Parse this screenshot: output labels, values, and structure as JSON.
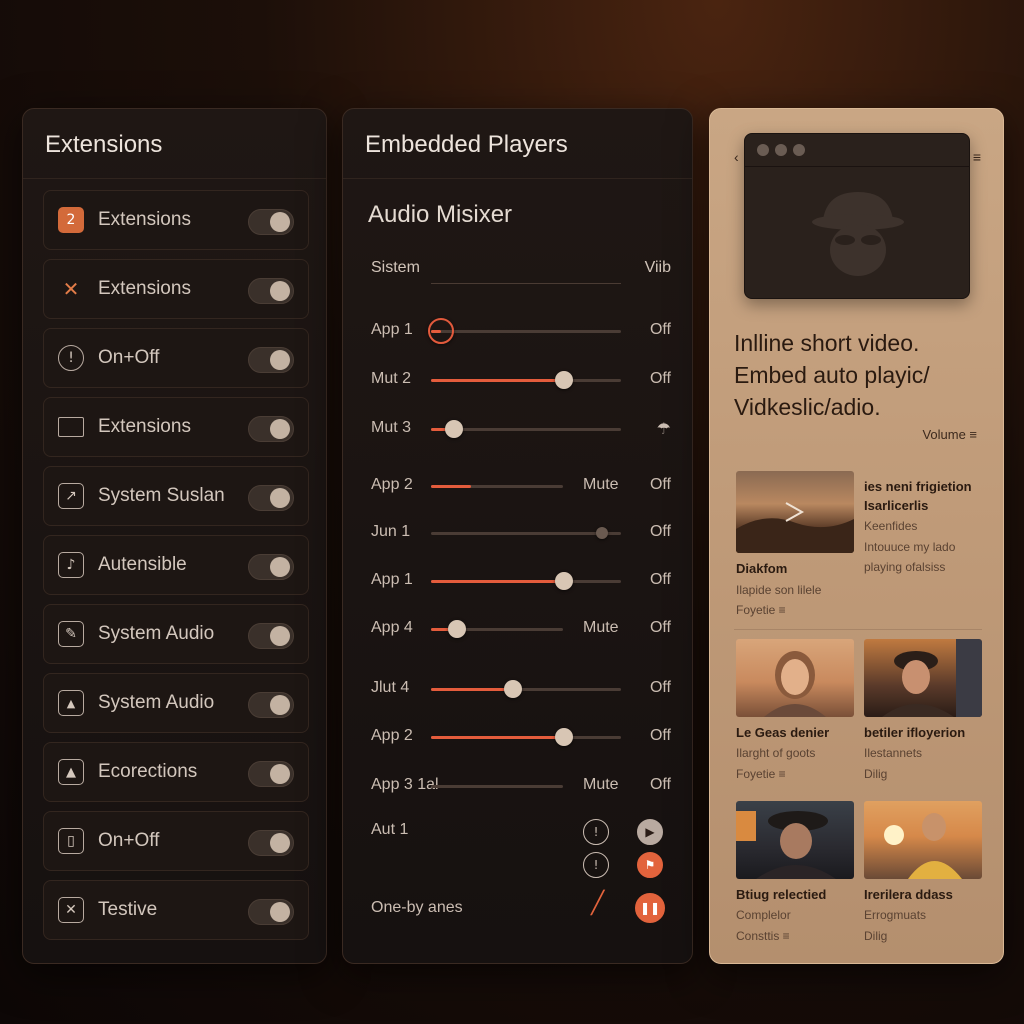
{
  "extensions": {
    "title": "Extensions",
    "items": [
      {
        "label": "Extensions",
        "icon": "puzzle-icon",
        "glyph": "2"
      },
      {
        "label": "Extensions",
        "icon": "cross-icon",
        "glyph": "✕"
      },
      {
        "label": "On+Off",
        "icon": "info-icon",
        "glyph": "!"
      },
      {
        "label": "Extensions",
        "icon": "window-icon",
        "glyph": ""
      },
      {
        "label": "System Suslan",
        "icon": "arrow-icon",
        "glyph": "↗"
      },
      {
        "label": "Autensible",
        "icon": "music-note-icon",
        "glyph": "♪"
      },
      {
        "label": "System Audio",
        "icon": "pen-icon",
        "glyph": "✎"
      },
      {
        "label": "System Audio",
        "icon": "image-icon",
        "glyph": "▲"
      },
      {
        "label": "Ecorections",
        "icon": "warning-icon",
        "glyph": "▲"
      },
      {
        "label": "On+Off",
        "icon": "battery-icon",
        "glyph": "▯"
      },
      {
        "label": "Testive",
        "icon": "close-icon",
        "glyph": "✕"
      }
    ]
  },
  "embedded": {
    "title": "Embedded Players",
    "mixer_title": "Audio Misixer",
    "header_left": "Sistem",
    "header_right": "Viib",
    "rows": [
      {
        "label": "App 1",
        "value": 0.05,
        "mute": "",
        "off": "Off",
        "knob": "ring"
      },
      {
        "label": "Mut 2",
        "value": 0.7,
        "mute": "",
        "off": "Off",
        "knob": "normal"
      },
      {
        "label": "Mut 3",
        "value": 0.12,
        "mute": "",
        "off": "",
        "knob": "normal"
      },
      {
        "label": "App 2",
        "value": 0.3,
        "mute": "Mute",
        "off": "Off",
        "knob": "none"
      },
      {
        "label": "Jun 1",
        "value": 0.0,
        "mute": "",
        "off": "Off",
        "knob": "small",
        "small_pos": 0.9
      },
      {
        "label": "App 1",
        "value": 0.7,
        "mute": "",
        "off": "Off",
        "knob": "normal"
      },
      {
        "label": "App 4",
        "value": 0.2,
        "mute": "Mute",
        "off": "Off",
        "knob": "normal"
      },
      {
        "label": "Jlut 4",
        "value": 0.43,
        "mute": "",
        "off": "Off",
        "knob": "normal"
      },
      {
        "label": "App 2",
        "value": 0.7,
        "mute": "",
        "off": "Off",
        "knob": "normal"
      },
      {
        "label": "App 3 1al",
        "value": 0.0,
        "mute": "Mute",
        "off": "Off",
        "knob": "none"
      }
    ],
    "aut_label": "Aut 1",
    "footer_label": "One-by anes"
  },
  "media": {
    "caption": "Inlline short video. Embed auto playic/ Vidkeslic/adio.",
    "volume_label": "Volume ≡",
    "cards": [
      {
        "title": "Diakfom",
        "sub1": "Ilapide son lilele",
        "sub2": "Foyetie ≡"
      },
      {
        "title": "Le Geas denier",
        "sub1": "Ilarght of goots",
        "sub2": "Foyetie ≡"
      },
      {
        "title": "betiler ifloyerion",
        "sub1": "Ilestannets",
        "sub2": "Dilig"
      },
      {
        "title": "Btiug relectied",
        "sub1": "Complelor",
        "sub2": "Consttis ≡"
      },
      {
        "title": "Irerilera ddass",
        "sub1": "Errogmuats",
        "sub2": "Dilig"
      }
    ],
    "side_text": {
      "title": "ies neni frigietion Isarlicerlis",
      "line1": "Keenfides",
      "line2": "Intouuce my lado",
      "line3": "playing ofalsiss"
    }
  }
}
